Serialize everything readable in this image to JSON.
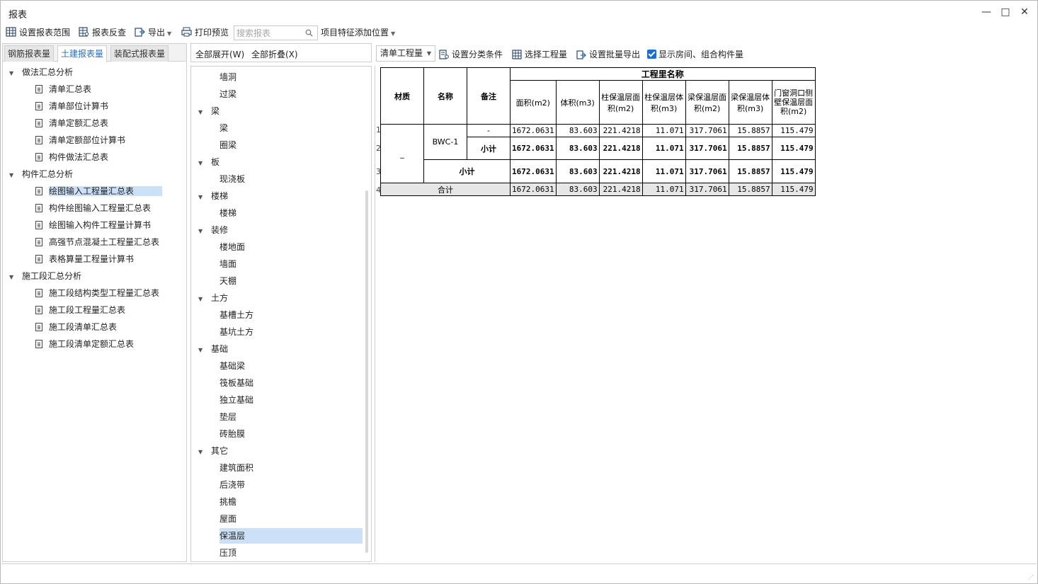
{
  "window": {
    "title": "报表"
  },
  "toolbar": {
    "set_range": "设置报表范围",
    "reverse_check": "报表反查",
    "export": "导出",
    "print_preview": "打印预览",
    "search_placeholder": "搜索报表",
    "feature_position": "项目特征添加位置"
  },
  "left_tabs": [
    "钢筋报表量",
    "土建报表量",
    "装配式报表量"
  ],
  "left_tree": {
    "group1": "做法汇总分析",
    "group1_items": [
      "清单汇总表",
      "清单部位计算书",
      "清单定额汇总表",
      "清单定额部位计算书",
      "构件做法汇总表"
    ],
    "group2": "构件汇总分析",
    "group2_items": [
      "绘图输入工程量汇总表",
      "构件绘图输入工程量汇总表",
      "绘图输入构件工程量计算书",
      "高强节点混凝土工程量汇总表",
      "表格算量工程量计算书"
    ],
    "group3": "施工段汇总分析",
    "group3_items": [
      "施工段结构类型工程量汇总表",
      "施工段工程量汇总表",
      "施工段清单汇总表",
      "施工段清单定额汇总表"
    ]
  },
  "middle": {
    "expand_all": "全部展开(W)",
    "collapse_all": "全部折叠(X)",
    "tree": [
      {
        "label": "墙洞",
        "level": 1
      },
      {
        "label": "过梁",
        "level": 1
      },
      {
        "label": "梁",
        "level": 0
      },
      {
        "label": "梁",
        "level": 1
      },
      {
        "label": "圈梁",
        "level": 1
      },
      {
        "label": "板",
        "level": 0
      },
      {
        "label": "现浇板",
        "level": 1
      },
      {
        "label": "楼梯",
        "level": 0
      },
      {
        "label": "楼梯",
        "level": 1
      },
      {
        "label": "装修",
        "level": 0
      },
      {
        "label": "楼地面",
        "level": 1
      },
      {
        "label": "墙面",
        "level": 1
      },
      {
        "label": "天棚",
        "level": 1
      },
      {
        "label": "土方",
        "level": 0
      },
      {
        "label": "基槽土方",
        "level": 1
      },
      {
        "label": "基坑土方",
        "level": 1
      },
      {
        "label": "基础",
        "level": 0
      },
      {
        "label": "基础梁",
        "level": 1
      },
      {
        "label": "筏板基础",
        "level": 1
      },
      {
        "label": "独立基础",
        "level": 1
      },
      {
        "label": "垫层",
        "level": 1
      },
      {
        "label": "砖胎膜",
        "level": 1
      },
      {
        "label": "其它",
        "level": 0
      },
      {
        "label": "建筑面积",
        "level": 1
      },
      {
        "label": "后浇带",
        "level": 1
      },
      {
        "label": "挑檐",
        "level": 1
      },
      {
        "label": "屋面",
        "level": 1
      },
      {
        "label": "保温层",
        "level": 1
      },
      {
        "label": "压顶",
        "level": 1
      }
    ]
  },
  "right_toolbar": {
    "combo_value": "清单工程量",
    "set_category": "设置分类条件",
    "select_quantity": "选择工程量",
    "batch_export": "设置批量导出",
    "show_rooms": "显示房间、组合构件量"
  },
  "report": {
    "col_material": "材质",
    "col_name": "名称",
    "col_note": "备注",
    "group_header": "工程里名称",
    "qty_headers": [
      "面积(m2)",
      "体积(m3)",
      "柱保温层面积(m2)",
      "柱保温层体积(m3)",
      "梁保温层面积(m2)",
      "梁保温层体积(m3)",
      "门窗洞口侧壁保温层面积(m2)"
    ],
    "row_numbers": [
      "1",
      "2",
      "3",
      "4"
    ],
    "material_value": "_",
    "name_value": "BWC-1",
    "note_value": "-",
    "subtotal_label": "小计",
    "total_label": "合计",
    "row1": [
      "1672.0631",
      "83.603",
      "221.4218",
      "11.071",
      "317.7061",
      "15.8857",
      "115.479"
    ],
    "row2": [
      "1672.0631",
      "83.603",
      "221.4218",
      "11.071",
      "317.7061",
      "15.8857",
      "115.479"
    ],
    "row3": [
      "1672.0631",
      "83.603",
      "221.4218",
      "11.071",
      "317.7061",
      "15.8857",
      "115.479"
    ],
    "row4": [
      "1672.0631",
      "83.603",
      "221.4218",
      "11.071",
      "317.7061",
      "15.8857",
      "115.479"
    ]
  },
  "colors": {
    "accent": "#2a6ebb",
    "selection": "#cce1f7",
    "checkbox": "#1a6fd1"
  }
}
